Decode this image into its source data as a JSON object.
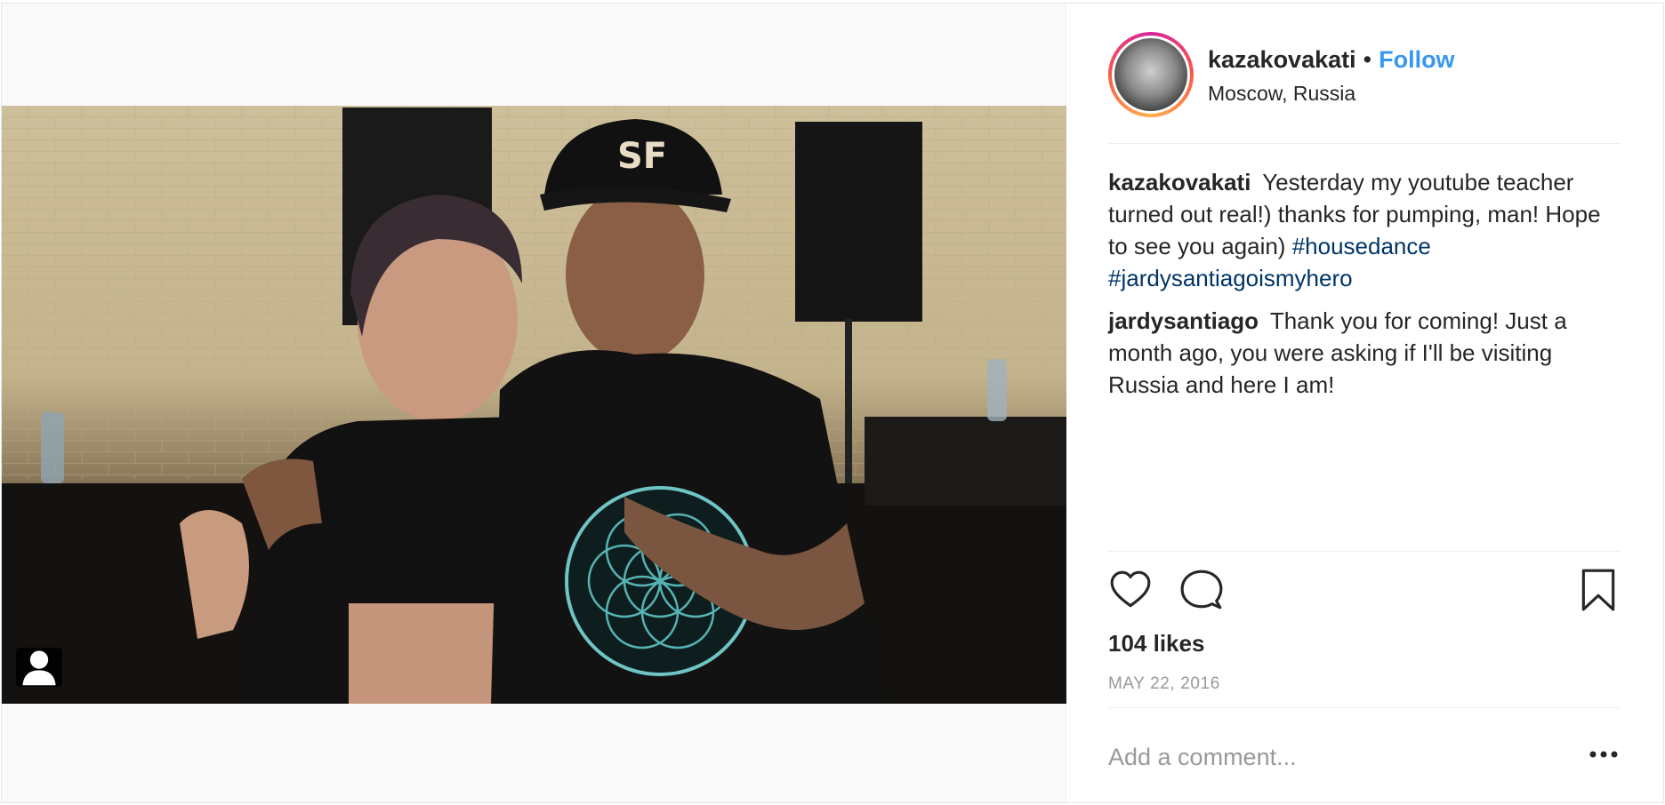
{
  "post": {
    "media": {
      "photo_alt": "",
      "tag_icon": "user-tag-icon"
    },
    "header": {
      "username": "kazakovakati",
      "separator": "•",
      "follow_label": "Follow",
      "location": "Moscow, Russia"
    },
    "comments": [
      {
        "user": "kazakovakati",
        "text": "Yesterday my youtube teacher turned out real!) thanks for pumping, man! Hope to see you again)",
        "hashtags": [
          "#housedance",
          "#jardysantiagoismyhero"
        ]
      },
      {
        "user": "jardysantiago",
        "text": "Thank you for coming! Just a month ago, you were asking if I'll be visiting Russia and here I am!"
      }
    ],
    "actions": {
      "like_icon": "heart-icon",
      "comment_icon": "comment-bubble-icon",
      "save_icon": "bookmark-icon"
    },
    "likes": "104 likes",
    "date": "MAY 22, 2016",
    "add_comment_placeholder": "Add a comment...",
    "more_icon": "more-options-icon"
  },
  "colors": {
    "accent": "#3897f0",
    "hashtag": "#003569",
    "text": "#262626",
    "muted": "#999999",
    "divider": "#efefef"
  }
}
